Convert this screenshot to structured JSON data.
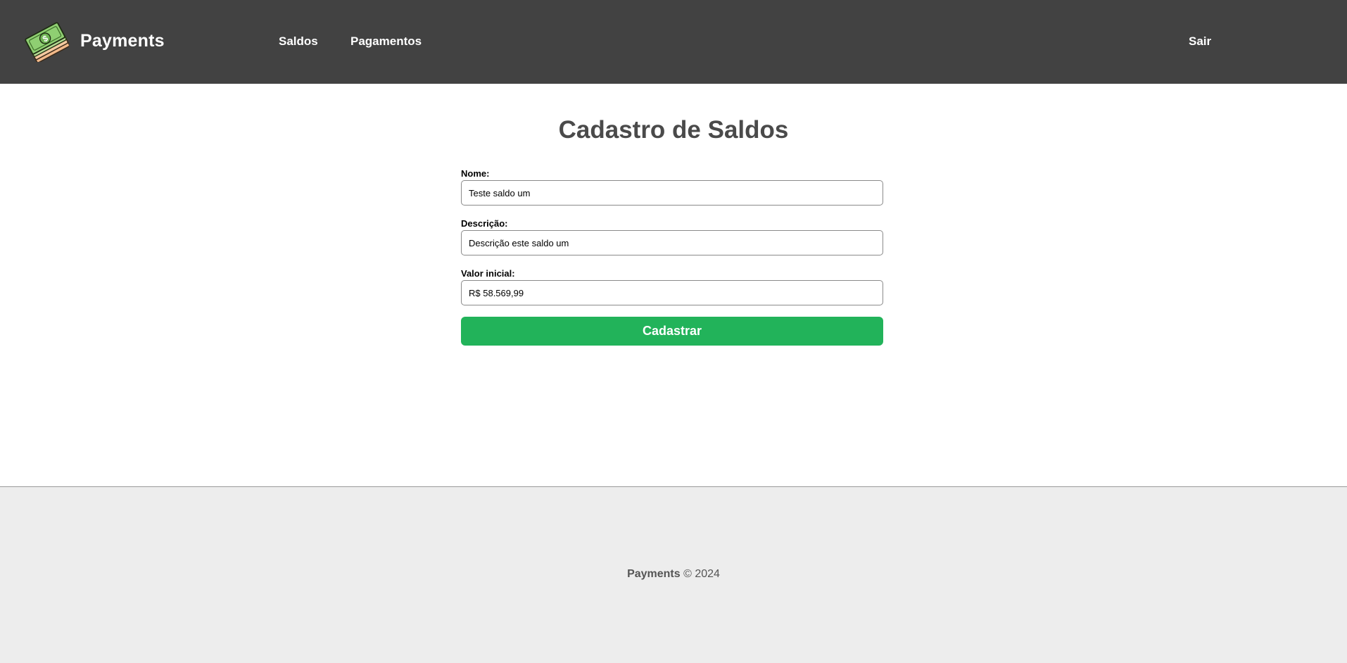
{
  "header": {
    "brand_name": "Payments",
    "logo_icon": "money-stack-icon",
    "nav": [
      {
        "label": "Saldos"
      },
      {
        "label": "Pagamentos"
      }
    ],
    "logout_label": "Sair"
  },
  "main": {
    "title": "Cadastro de Saldos",
    "form": {
      "nome": {
        "label": "Nome:",
        "value": "Teste saldo um"
      },
      "descricao": {
        "label": "Descrição:",
        "value": "Descrição este saldo um"
      },
      "valor_inicial": {
        "label": "Valor inicial:",
        "value": "R$ 58.569,99"
      },
      "submit_label": "Cadastrar"
    }
  },
  "footer": {
    "brand": "Payments",
    "copyright": " © 2024"
  },
  "colors": {
    "header_bg": "#424242",
    "submit_bg": "#22b35a",
    "footer_bg": "#ededed"
  }
}
